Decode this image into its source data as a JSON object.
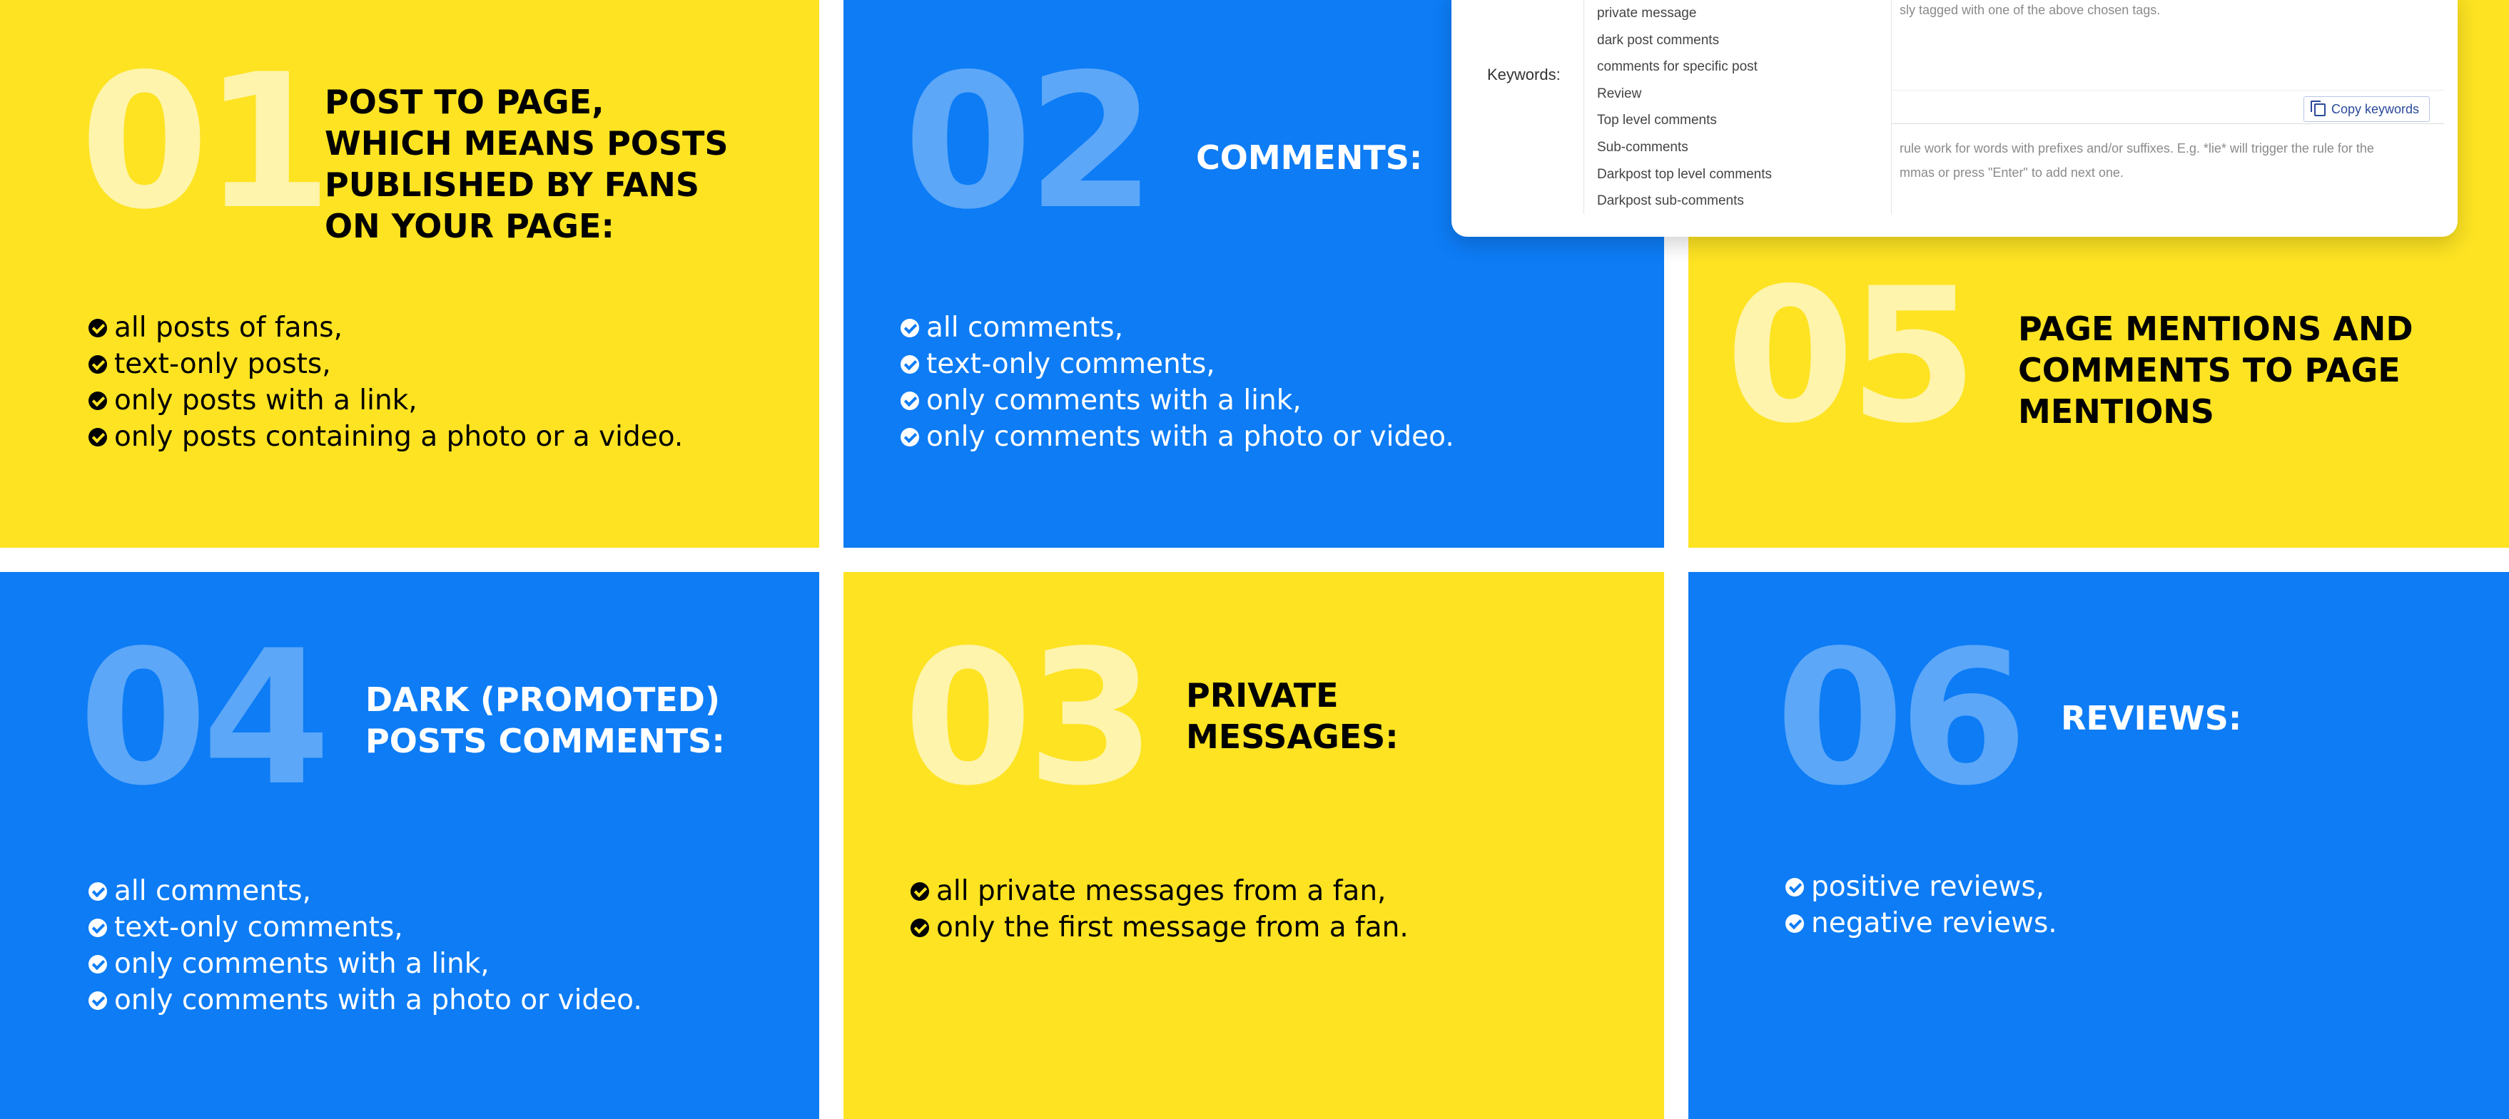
{
  "panels": {
    "p01": {
      "number": "01",
      "title": "POST TO PAGE,\nWHICH MEANS POSTS\nPUBLISHED BY FANS\nON YOUR PAGE:",
      "items": [
        "all posts of fans,",
        "text-only posts,",
        "only posts with a link,",
        "only posts containing a photo or a video."
      ]
    },
    "p02": {
      "number": "02",
      "title": "COMMENTS:",
      "items": [
        "all comments,",
        "text-only comments,",
        "only comments with a link,",
        "only comments with a photo or video."
      ]
    },
    "p05": {
      "number": "05",
      "title": "PAGE MENTIONS AND\nCOMMENTS TO PAGE\nMENTIONS",
      "items": []
    },
    "p04": {
      "number": "04",
      "title": "DARK (PROMOTED)\nPOSTS COMMENTS:",
      "items": [
        "all comments,",
        "text-only comments,",
        "only comments with a link,",
        "only comments with a photo or video."
      ]
    },
    "p03": {
      "number": "03",
      "title": "PRIVATE\nMESSAGES:",
      "items": [
        "all private messages from a fan,",
        "only the first message from a fan."
      ]
    },
    "p06": {
      "number": "06",
      "title": "REVIEWS:",
      "items": [
        "positive reviews,",
        "negative reviews."
      ]
    }
  },
  "overlay": {
    "keywords_label": "Keywords:",
    "dropdown_options": [
      "private message",
      "dark post comments",
      "comments for specific post",
      "Review",
      "Top level comments",
      "Sub-comments",
      "Darkpost top level comments",
      "Darkpost sub-comments"
    ],
    "hint_top": "sly tagged with one of the above chosen tags.",
    "hint_line1": "rule work for words with prefixes and/or suffixes. E.g. *lie* will trigger the rule for the",
    "hint_line2": "mmas or press \"Enter\" to add next one.",
    "copy_button": "Copy keywords"
  },
  "colors": {
    "yellow": "#FDE322",
    "blue": "#0D7CF5"
  }
}
